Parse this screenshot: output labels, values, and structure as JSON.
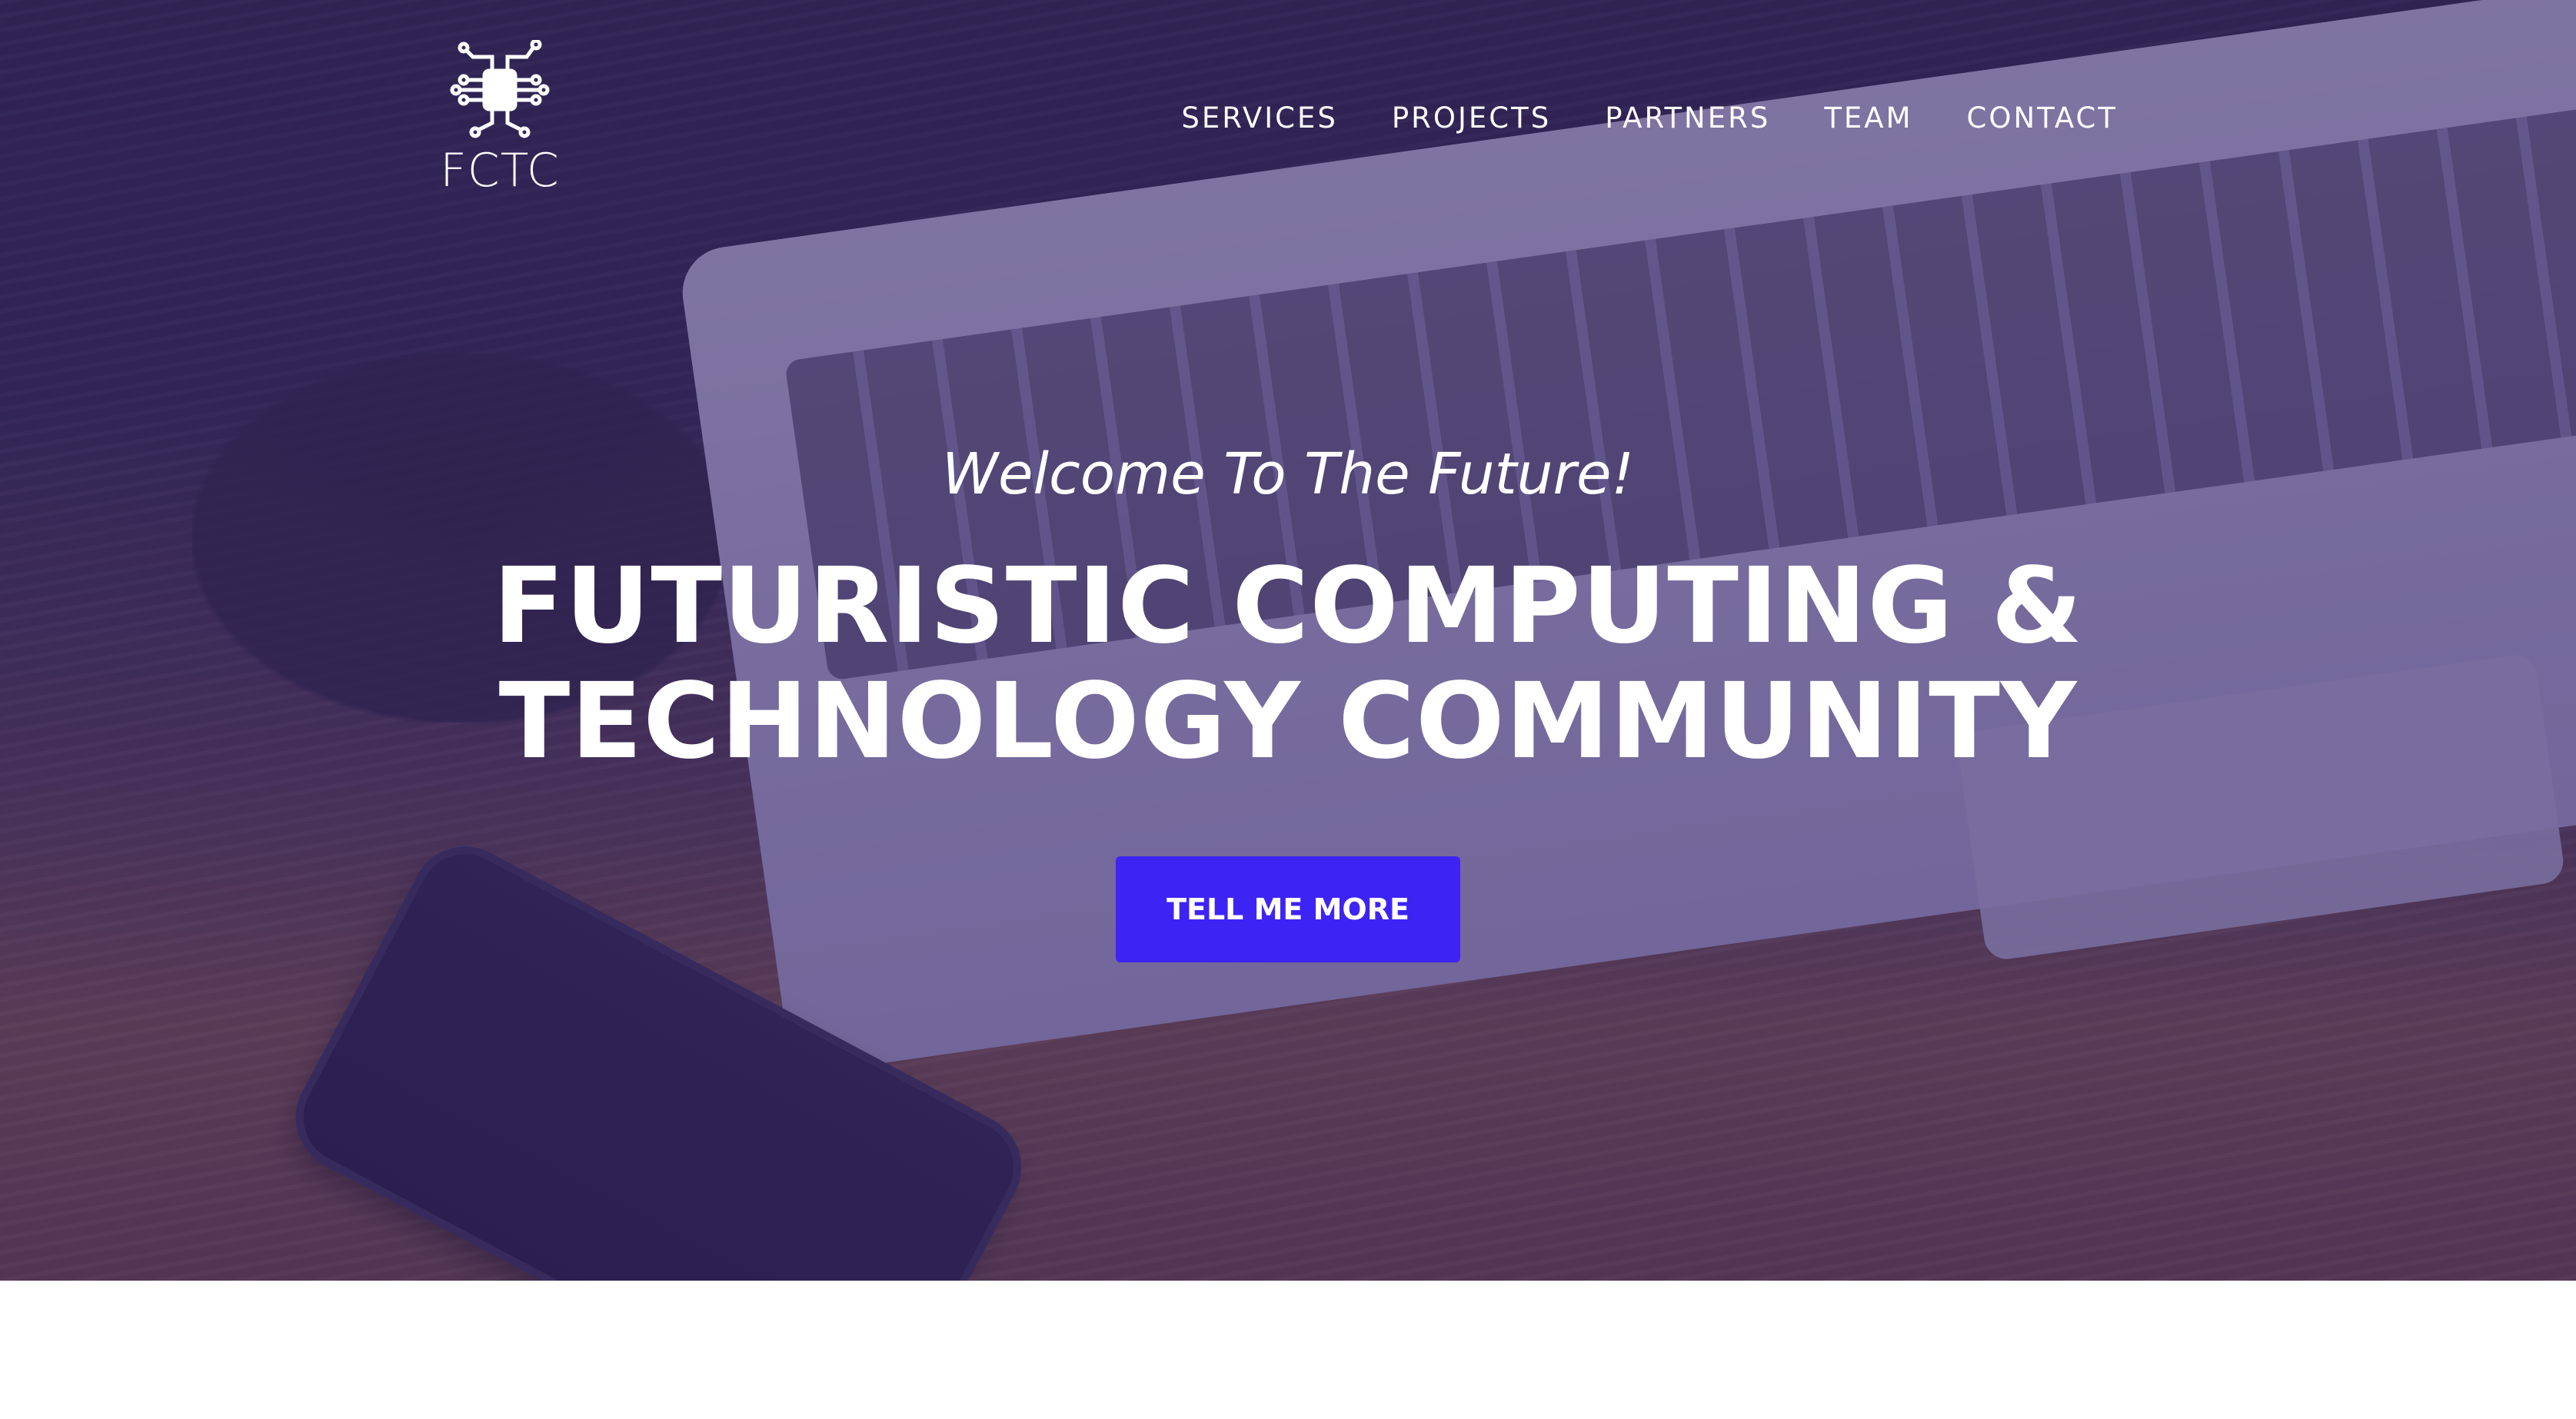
{
  "brand": {
    "name": "FCTC",
    "logo_icon": "circuit-chip-icon"
  },
  "nav": {
    "items": [
      {
        "label": "SERVICES"
      },
      {
        "label": "PROJECTS"
      },
      {
        "label": "PARTNERS"
      },
      {
        "label": "TEAM"
      },
      {
        "label": "CONTACT"
      }
    ]
  },
  "hero": {
    "subheading": "Welcome To The Future!",
    "heading_line1": "FUTURISTIC COMPUTING &",
    "heading_line2": "TECHNOLOGY COMMUNITY",
    "cta_label": "TELL ME MORE"
  },
  "colors": {
    "accent": "#3d24f5",
    "overlay": "#342464"
  }
}
